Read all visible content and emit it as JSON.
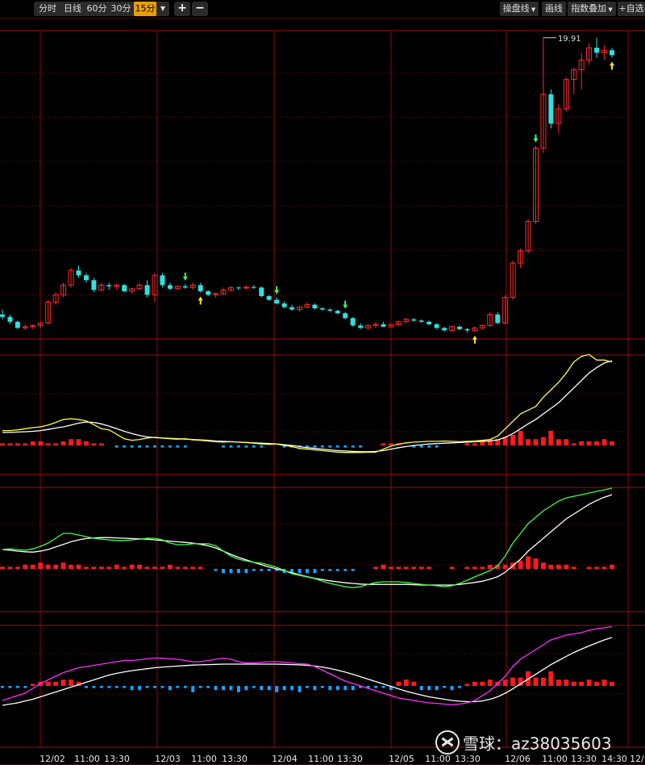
{
  "toolbar": {
    "periods": [
      "分时",
      "日线",
      "60分",
      "30分",
      "15分"
    ],
    "active_period": "15分",
    "zoom_in": "+",
    "zoom_out": "−",
    "right": [
      "操盘线",
      "画线",
      "指数叠加",
      "自选"
    ]
  },
  "price_panel": {
    "high_label": "19.91",
    "candles": [
      [
        8.6,
        8.8,
        8.4,
        8.5
      ],
      [
        8.5,
        8.6,
        8.2,
        8.3
      ],
      [
        8.3,
        8.35,
        8.0,
        8.05
      ],
      [
        8.05,
        8.2,
        7.95,
        8.1
      ],
      [
        8.1,
        8.2,
        8.0,
        8.15
      ],
      [
        8.15,
        8.3,
        8.05,
        8.25
      ],
      [
        8.25,
        9.2,
        8.2,
        9.1
      ],
      [
        9.1,
        9.5,
        9.0,
        9.4
      ],
      [
        9.4,
        9.9,
        9.3,
        9.8
      ],
      [
        9.8,
        10.5,
        9.7,
        10.4
      ],
      [
        10.4,
        10.6,
        10.1,
        10.2
      ],
      [
        10.2,
        10.3,
        9.9,
        10.0
      ],
      [
        10.0,
        10.1,
        9.5,
        9.6
      ],
      [
        9.6,
        9.9,
        9.55,
        9.8
      ],
      [
        9.8,
        9.9,
        9.6,
        9.75
      ],
      [
        9.75,
        9.85,
        9.6,
        9.8
      ],
      [
        9.8,
        9.85,
        9.5,
        9.55
      ],
      [
        9.55,
        9.7,
        9.45,
        9.65
      ],
      [
        9.65,
        9.9,
        9.6,
        9.8
      ],
      [
        9.8,
        10.0,
        9.3,
        9.4
      ],
      [
        9.4,
        10.3,
        9.1,
        10.2
      ],
      [
        10.2,
        10.3,
        9.7,
        9.8
      ],
      [
        9.8,
        9.9,
        9.6,
        9.65
      ],
      [
        9.65,
        9.8,
        9.6,
        9.75
      ],
      [
        9.75,
        9.85,
        9.65,
        9.7
      ],
      [
        9.7,
        9.9,
        9.6,
        9.8
      ],
      [
        9.8,
        9.9,
        9.5,
        9.55
      ],
      [
        9.55,
        9.6,
        9.35,
        9.4
      ],
      [
        9.4,
        9.5,
        9.3,
        9.45
      ],
      [
        9.45,
        9.7,
        9.4,
        9.6
      ],
      [
        9.6,
        9.75,
        9.55,
        9.7
      ],
      [
        9.7,
        9.75,
        9.6,
        9.68
      ],
      [
        9.68,
        9.8,
        9.6,
        9.72
      ],
      [
        9.72,
        9.8,
        9.65,
        9.7
      ],
      [
        9.7,
        9.75,
        9.3,
        9.35
      ],
      [
        9.35,
        9.4,
        9.15,
        9.2
      ],
      [
        9.2,
        9.3,
        9.0,
        9.05
      ],
      [
        9.05,
        9.15,
        8.85,
        8.9
      ],
      [
        8.9,
        9.0,
        8.75,
        8.8
      ],
      [
        8.8,
        8.95,
        8.7,
        8.9
      ],
      [
        8.9,
        9.1,
        8.85,
        9.0
      ],
      [
        9.0,
        9.05,
        8.8,
        8.85
      ],
      [
        8.85,
        8.9,
        8.75,
        8.8
      ],
      [
        8.8,
        8.85,
        8.7,
        8.75
      ],
      [
        8.75,
        8.8,
        8.6,
        8.65
      ],
      [
        8.65,
        8.7,
        8.4,
        8.45
      ],
      [
        8.45,
        8.5,
        8.1,
        8.15
      ],
      [
        8.15,
        8.25,
        8.0,
        8.05
      ],
      [
        8.05,
        8.2,
        8.0,
        8.15
      ],
      [
        8.15,
        8.3,
        8.05,
        8.2
      ],
      [
        8.2,
        8.3,
        8.1,
        8.1
      ],
      [
        8.1,
        8.2,
        8.05,
        8.18
      ],
      [
        8.18,
        8.35,
        8.15,
        8.3
      ],
      [
        8.3,
        8.45,
        8.25,
        8.4
      ],
      [
        8.4,
        8.45,
        8.3,
        8.35
      ],
      [
        8.35,
        8.4,
        8.25,
        8.3
      ],
      [
        8.3,
        8.35,
        8.15,
        8.2
      ],
      [
        8.2,
        8.25,
        8.0,
        8.05
      ],
      [
        8.05,
        8.1,
        7.9,
        7.95
      ],
      [
        7.95,
        8.15,
        7.9,
        8.1
      ],
      [
        8.1,
        8.15,
        7.95,
        8.0
      ],
      [
        8.0,
        8.05,
        7.85,
        7.95
      ],
      [
        7.95,
        8.1,
        7.9,
        8.05
      ],
      [
        8.05,
        8.2,
        8.0,
        8.15
      ],
      [
        8.15,
        8.7,
        8.1,
        8.6
      ],
      [
        8.6,
        8.7,
        8.2,
        8.25
      ],
      [
        8.25,
        9.4,
        8.2,
        9.3
      ],
      [
        9.3,
        10.8,
        9.2,
        10.7
      ],
      [
        10.7,
        11.3,
        10.5,
        11.2
      ],
      [
        11.2,
        12.5,
        11.1,
        12.4
      ],
      [
        12.4,
        15.5,
        12.3,
        15.4
      ],
      [
        15.4,
        19.91,
        15.2,
        17.6
      ],
      [
        17.6,
        17.8,
        16.2,
        16.4
      ],
      [
        16.4,
        17.2,
        16.0,
        17.0
      ],
      [
        17.0,
        18.3,
        16.9,
        18.2
      ],
      [
        18.2,
        18.7,
        17.6,
        18.6
      ],
      [
        18.6,
        19.3,
        17.8,
        19.0
      ],
      [
        19.0,
        19.7,
        18.8,
        19.5
      ],
      [
        19.5,
        19.91,
        19.1,
        19.3
      ],
      [
        19.3,
        19.6,
        19.0,
        19.4
      ],
      [
        19.4,
        19.5,
        19.1,
        19.2
      ]
    ],
    "green_down_arrows": [
      24,
      36,
      45,
      70
    ],
    "yellow_up_arrows": [
      26,
      62,
      80
    ]
  },
  "indicator1": {
    "hist": [
      1,
      1,
      1,
      1,
      2,
      2,
      1,
      1,
      2,
      3,
      3,
      2,
      1,
      1,
      0,
      -1,
      -1,
      -1,
      -1,
      -1,
      -1,
      -1,
      -1,
      -1,
      -1,
      0,
      0,
      0,
      0,
      -1,
      -1,
      -1,
      -1,
      -1,
      -1,
      0,
      0,
      -1,
      -1,
      -1,
      -1,
      -1,
      -1,
      -1,
      -1,
      -1,
      -1,
      -1,
      0,
      0,
      1,
      1,
      1,
      0,
      -1,
      -1,
      -1,
      -1,
      0,
      0,
      0,
      1,
      1,
      2,
      3,
      3,
      4,
      5,
      7,
      3,
      3,
      4,
      7,
      3,
      3,
      1,
      2,
      2,
      2,
      3,
      2
    ],
    "fast": [
      0.4,
      0.4,
      0.42,
      0.45,
      0.48,
      0.5,
      0.55,
      0.62,
      0.7,
      0.72,
      0.7,
      0.66,
      0.56,
      0.45,
      0.42,
      0.3,
      0.18,
      0.14,
      0.16,
      0.2,
      0.22,
      0.2,
      0.18,
      0.17,
      0.18,
      0.15,
      0.14,
      0.12,
      0.1,
      0.09,
      0.1,
      0.09,
      0.08,
      0.06,
      0.04,
      0.03,
      0.04,
      0.0,
      -0.03,
      -0.08,
      -0.1,
      -0.12,
      -0.14,
      -0.16,
      -0.18,
      -0.19,
      -0.19,
      -0.19,
      -0.18,
      -0.18,
      -0.1,
      -0.02,
      0.04,
      0.07,
      0.09,
      0.1,
      0.11,
      0.11,
      0.12,
      0.11,
      0.1,
      0.11,
      0.12,
      0.14,
      0.16,
      0.25,
      0.45,
      0.65,
      0.85,
      0.95,
      1.05,
      1.3,
      1.5,
      1.7,
      1.95,
      2.25,
      2.4,
      2.45,
      2.3,
      2.3,
      2.25
    ],
    "slow": [
      0.35,
      0.35,
      0.36,
      0.37,
      0.38,
      0.4,
      0.43,
      0.47,
      0.5,
      0.55,
      0.6,
      0.63,
      0.62,
      0.58,
      0.52,
      0.45,
      0.38,
      0.32,
      0.27,
      0.23,
      0.21,
      0.2,
      0.19,
      0.18,
      0.17,
      0.16,
      0.15,
      0.14,
      0.12,
      0.11,
      0.1,
      0.09,
      0.08,
      0.07,
      0.06,
      0.05,
      0.04,
      0.02,
      0.0,
      -0.03,
      -0.06,
      -0.08,
      -0.1,
      -0.12,
      -0.14,
      -0.15,
      -0.16,
      -0.17,
      -0.17,
      -0.16,
      -0.14,
      -0.1,
      -0.06,
      -0.03,
      0.0,
      0.02,
      0.04,
      0.05,
      0.06,
      0.07,
      0.08,
      0.09,
      0.1,
      0.11,
      0.12,
      0.15,
      0.22,
      0.32,
      0.45,
      0.58,
      0.7,
      0.85,
      1.0,
      1.15,
      1.35,
      1.55,
      1.75,
      1.95,
      2.1,
      2.22,
      2.28
    ]
  },
  "indicator2": {
    "hist": [
      1,
      1,
      1,
      2,
      2,
      3,
      2,
      2,
      3,
      2,
      2,
      1,
      1,
      1,
      1,
      2,
      1,
      2,
      2,
      1,
      1,
      1,
      2,
      1,
      1,
      1,
      1,
      0,
      -1,
      -2,
      -2,
      -2,
      -2,
      -1,
      -1,
      -1,
      -1,
      -2,
      -2,
      -2,
      -2,
      -2,
      -1,
      -1,
      -1,
      -1,
      -1,
      0,
      0,
      1,
      2,
      1,
      1,
      1,
      1,
      1,
      1,
      0,
      0,
      1,
      0,
      1,
      1,
      1,
      2,
      2,
      2,
      3,
      4,
      6,
      5,
      3,
      2,
      2,
      2,
      1,
      0,
      1,
      1,
      1,
      2
    ],
    "fast": [
      0.6,
      0.62,
      0.6,
      0.58,
      0.62,
      0.7,
      0.8,
      0.95,
      1.1,
      1.1,
      1.05,
      1.0,
      0.95,
      0.92,
      0.9,
      0.88,
      0.88,
      0.9,
      0.92,
      0.95,
      0.95,
      0.9,
      0.8,
      0.75,
      0.75,
      0.78,
      0.78,
      0.78,
      0.72,
      0.55,
      0.4,
      0.3,
      0.25,
      0.2,
      0.18,
      0.12,
      0.05,
      -0.05,
      -0.15,
      -0.2,
      -0.25,
      -0.3,
      -0.38,
      -0.45,
      -0.5,
      -0.55,
      -0.58,
      -0.55,
      -0.48,
      -0.42,
      -0.4,
      -0.4,
      -0.4,
      -0.42,
      -0.45,
      -0.48,
      -0.5,
      -0.52,
      -0.55,
      -0.52,
      -0.45,
      -0.35,
      -0.25,
      -0.15,
      -0.05,
      0.1,
      0.4,
      0.8,
      1.1,
      1.4,
      1.6,
      1.8,
      1.95,
      2.1,
      2.2,
      2.25,
      2.3,
      2.35,
      2.4,
      2.45,
      2.5
    ],
    "slow": [
      0.6,
      0.58,
      0.55,
      0.53,
      0.52,
      0.55,
      0.6,
      0.68,
      0.76,
      0.84,
      0.9,
      0.94,
      0.96,
      0.97,
      0.97,
      0.96,
      0.95,
      0.94,
      0.93,
      0.92,
      0.9,
      0.88,
      0.86,
      0.84,
      0.82,
      0.8,
      0.76,
      0.72,
      0.65,
      0.55,
      0.45,
      0.36,
      0.28,
      0.2,
      0.13,
      0.06,
      0.0,
      -0.06,
      -0.12,
      -0.18,
      -0.24,
      -0.29,
      -0.33,
      -0.37,
      -0.4,
      -0.43,
      -0.45,
      -0.47,
      -0.48,
      -0.48,
      -0.48,
      -0.48,
      -0.48,
      -0.48,
      -0.49,
      -0.5,
      -0.5,
      -0.5,
      -0.5,
      -0.5,
      -0.48,
      -0.45,
      -0.42,
      -0.38,
      -0.32,
      -0.24,
      -0.1,
      0.1,
      0.3,
      0.55,
      0.75,
      0.95,
      1.15,
      1.35,
      1.55,
      1.7,
      1.85,
      2.0,
      2.12,
      2.22,
      2.3
    ]
  },
  "indicator3": {
    "hist": [
      -1,
      -1,
      -1,
      -1,
      1,
      2,
      2,
      2,
      3,
      3,
      2,
      -1,
      -1,
      -1,
      -1,
      -1,
      -1,
      -2,
      -2,
      -1,
      -1,
      -1,
      -2,
      -1,
      -1,
      -3,
      -1,
      -1,
      -2,
      -2,
      -2,
      -3,
      -2,
      -1,
      -2,
      -2,
      -3,
      -2,
      -2,
      -3,
      -1,
      -2,
      -1,
      -2,
      -2,
      -2,
      -2,
      -1,
      -1,
      -1,
      -1,
      -2,
      2,
      3,
      2,
      -2,
      -2,
      -2,
      -1,
      -2,
      -1,
      1,
      2,
      2,
      3,
      2,
      3,
      4,
      4,
      7,
      4,
      4,
      7,
      3,
      3,
      2,
      2,
      3,
      2,
      3,
      2
    ],
    "fast": [
      -0.6,
      -0.5,
      -0.4,
      -0.3,
      -0.1,
      0.1,
      0.25,
      0.4,
      0.55,
      0.65,
      0.75,
      0.8,
      0.85,
      0.9,
      0.95,
      1.0,
      1.05,
      1.05,
      1.08,
      1.12,
      1.15,
      1.15,
      1.12,
      1.1,
      1.05,
      1.0,
      1.0,
      1.05,
      1.1,
      1.15,
      1.1,
      1.0,
      0.95,
      0.95,
      0.98,
      1.0,
      1.0,
      0.98,
      0.95,
      0.92,
      0.9,
      0.8,
      0.65,
      0.5,
      0.35,
      0.2,
      0.1,
      0.0,
      -0.1,
      -0.2,
      -0.3,
      -0.4,
      -0.5,
      -0.55,
      -0.6,
      -0.65,
      -0.7,
      -0.72,
      -0.75,
      -0.78,
      -0.75,
      -0.7,
      -0.6,
      -0.4,
      -0.2,
      0.1,
      0.4,
      0.8,
      1.1,
      1.3,
      1.5,
      1.7,
      1.9,
      2.0,
      2.1,
      2.15,
      2.2,
      2.3,
      2.35,
      2.4,
      2.45
    ],
    "slow": [
      -0.8,
      -0.75,
      -0.7,
      -0.62,
      -0.55,
      -0.45,
      -0.35,
      -0.25,
      -0.15,
      -0.05,
      0.05,
      0.15,
      0.25,
      0.35,
      0.45,
      0.52,
      0.58,
      0.63,
      0.67,
      0.71,
      0.75,
      0.78,
      0.8,
      0.82,
      0.84,
      0.86,
      0.87,
      0.88,
      0.89,
      0.9,
      0.9,
      0.9,
      0.9,
      0.9,
      0.9,
      0.9,
      0.9,
      0.89,
      0.88,
      0.87,
      0.85,
      0.82,
      0.78,
      0.72,
      0.65,
      0.57,
      0.48,
      0.38,
      0.28,
      0.18,
      0.08,
      -0.02,
      -0.12,
      -0.22,
      -0.3,
      -0.38,
      -0.45,
      -0.5,
      -0.55,
      -0.6,
      -0.63,
      -0.65,
      -0.65,
      -0.62,
      -0.55,
      -0.45,
      -0.3,
      -0.12,
      0.08,
      0.28,
      0.48,
      0.68,
      0.88,
      1.05,
      1.22,
      1.38,
      1.52,
      1.65,
      1.78,
      1.9,
      2.0
    ]
  },
  "xaxis": {
    "labels": [
      "12/02",
      "11:00",
      "13:30",
      "12/03",
      "11:00",
      "13:30",
      "12/04",
      "11:00",
      "13:30",
      "12/05",
      "11:00",
      "13:30",
      "12/06",
      "11:00",
      "13:30",
      "14:30",
      "12/"
    ]
  },
  "watermark": {
    "text": "雪球：az38035603"
  },
  "colors": {
    "up": "#ff2a2a",
    "down": "#30e0e0",
    "grid": "#8b0a0a",
    "frame": "#a01010",
    "yellow": "#ffff40",
    "green": "#40ff40",
    "magenta": "#ff30ff",
    "white": "#ffffff",
    "hist_up": "#ff1a1a",
    "hist_down": "#1aa0ff",
    "arrow_up": "#ffdd33",
    "arrow_down": "#33ff66"
  }
}
